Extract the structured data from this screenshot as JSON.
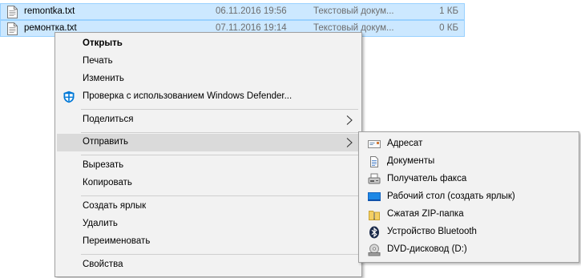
{
  "files": [
    {
      "name": "remontka.txt",
      "date": "06.11.2016 19:56",
      "type": "Текстовый докум...",
      "size": "1 КБ"
    },
    {
      "name": "ремонтка.txt",
      "date": "07.11.2016 19:14",
      "type": "Текстовый докум...",
      "size": "0 КБ"
    }
  ],
  "context_menu": {
    "open": "Открыть",
    "print": "Печать",
    "edit": "Изменить",
    "defender_scan": "Проверка с использованием Windows Defender...",
    "share": "Поделиться",
    "send_to": "Отправить",
    "cut": "Вырезать",
    "copy": "Копировать",
    "create_shortcut": "Создать ярлык",
    "delete": "Удалить",
    "rename": "Переименовать",
    "properties": "Свойства"
  },
  "send_to_menu": {
    "mail_recipient": "Адресат",
    "documents": "Документы",
    "fax_recipient": "Получатель факса",
    "desktop_shortcut": "Рабочий стол (создать ярлык)",
    "zip_folder": "Сжатая ZIP-папка",
    "bluetooth_device": "Устройство Bluetooth",
    "dvd_drive": "DVD-дисковод (D:)"
  },
  "colors": {
    "selection_bg": "#cce8ff",
    "selection_border": "#99d1ff",
    "menu_bg": "#f2f2f2",
    "menu_highlight": "#dadada",
    "defender_blue": "#0078d7"
  },
  "icons": {
    "file": "text-file-icon",
    "defender": "windows-defender-icon",
    "submenu": "chevron-right-icon",
    "mail": "mail-recipient-icon",
    "documents": "documents-icon",
    "fax": "fax-icon",
    "desktop": "desktop-icon",
    "zip": "zip-folder-icon",
    "bluetooth": "bluetooth-icon",
    "dvd": "dvd-drive-icon"
  }
}
